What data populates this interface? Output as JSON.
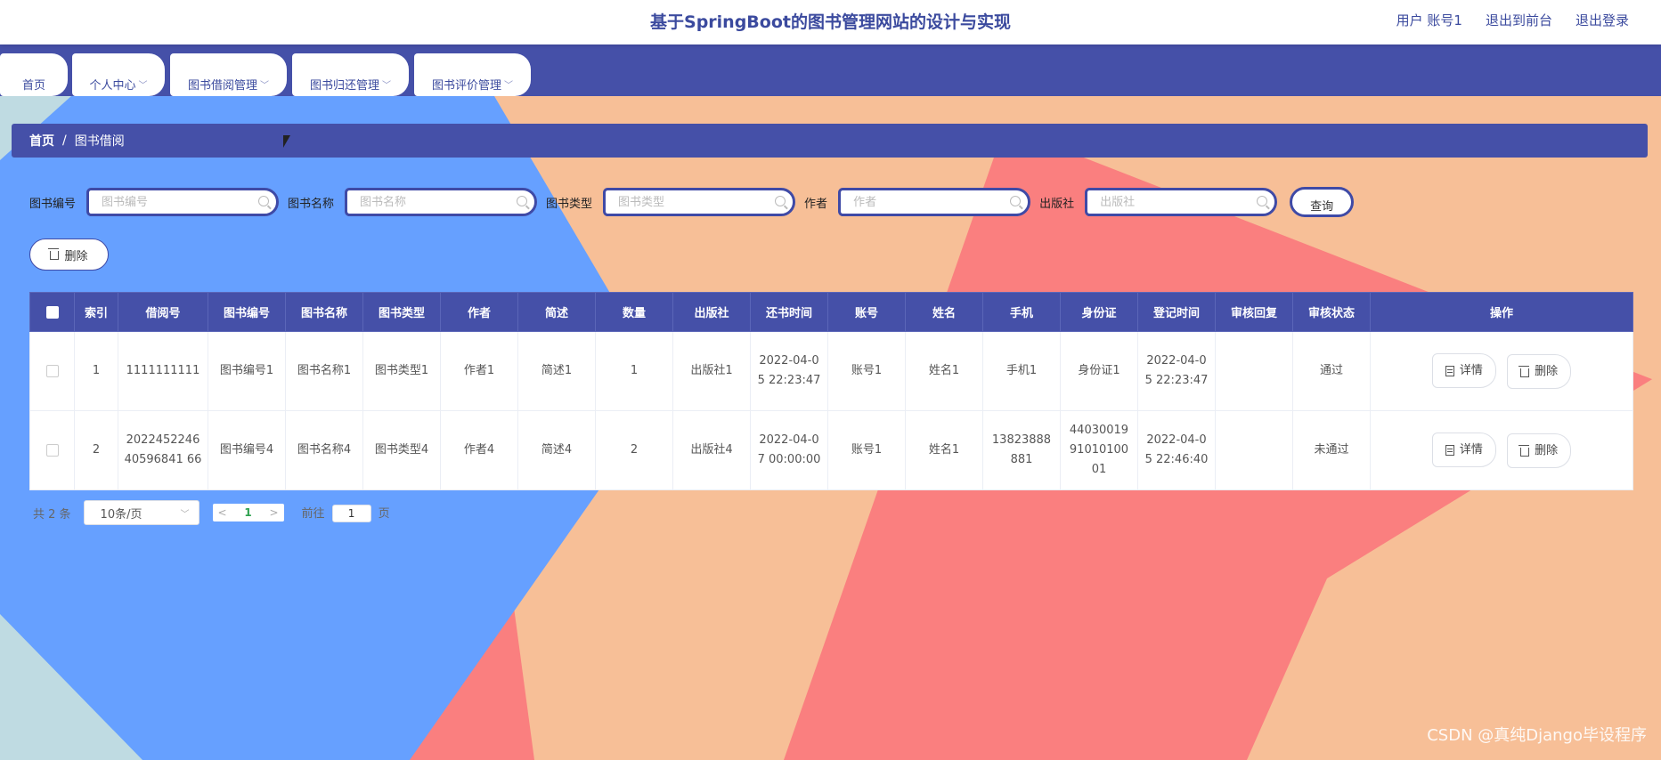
{
  "header": {
    "title": "基于SpringBoot的图书管理网站的设计与实现",
    "user_label": "用户 账号1",
    "exit_front": "退出到前台",
    "logout": "退出登录"
  },
  "nav": {
    "tabs": [
      {
        "label": "首页"
      },
      {
        "label": "个人中心"
      },
      {
        "label": "图书借阅管理"
      },
      {
        "label": "图书归还管理"
      },
      {
        "label": "图书评价管理"
      }
    ]
  },
  "breadcrumb": {
    "home": "首页",
    "sep": "/",
    "current": "图书借阅"
  },
  "search": {
    "fields": [
      {
        "label": "图书编号",
        "placeholder": "图书编号"
      },
      {
        "label": "图书名称",
        "placeholder": "图书名称"
      },
      {
        "label": "图书类型",
        "placeholder": "图书类型"
      },
      {
        "label": "作者",
        "placeholder": "作者"
      },
      {
        "label": "出版社",
        "placeholder": "出版社"
      }
    ],
    "query_label": "查询"
  },
  "toolbar": {
    "delete_label": "删除"
  },
  "table": {
    "headers": [
      "索引",
      "借阅号",
      "图书编号",
      "图书名称",
      "图书类型",
      "作者",
      "简述",
      "数量",
      "出版社",
      "还书时间",
      "账号",
      "姓名",
      "手机",
      "身份证",
      "登记时间",
      "审核回复",
      "审核状态",
      "操作"
    ],
    "rows": [
      {
        "index": "1",
        "borrow_no": "1111111111",
        "book_no": "图书编号1",
        "book_name": "图书名称1",
        "book_type": "图书类型1",
        "author": "作者1",
        "summary": "简述1",
        "qty": "1",
        "publisher": "出版社1",
        "return_time": "2022-04-05 22:23:47",
        "account": "账号1",
        "name": "姓名1",
        "phone": "手机1",
        "id_card": "身份证1",
        "reg_time": "2022-04-05 22:23:47",
        "reply": "",
        "status": "通过"
      },
      {
        "index": "2",
        "borrow_no": "202245224640596841 66",
        "book_no": "图书编号4",
        "book_name": "图书名称4",
        "book_type": "图书类型4",
        "author": "作者4",
        "summary": "简述4",
        "qty": "2",
        "publisher": "出版社4",
        "return_time": "2022-04-07 00:00:00",
        "account": "账号1",
        "name": "姓名1",
        "phone": "13823888881",
        "id_card": "440300199101010001",
        "reg_time": "2022-04-05 22:46:40",
        "reply": "",
        "status": "未通过"
      }
    ],
    "detail_label": "详情",
    "delete_label": "删除"
  },
  "pager": {
    "total": "共 2 条",
    "page_size": "10条/页",
    "current": "1",
    "goto_prefix": "前往",
    "goto_value": "1",
    "goto_suffix": "页"
  },
  "watermark": "CSDN @真纯Django毕设程序",
  "colors": {
    "primary": "#4550a8",
    "blue": "#66a0ff",
    "peach": "#f7bf97",
    "coral": "#fa7f7f",
    "lightblue": "#bfdbe2"
  }
}
